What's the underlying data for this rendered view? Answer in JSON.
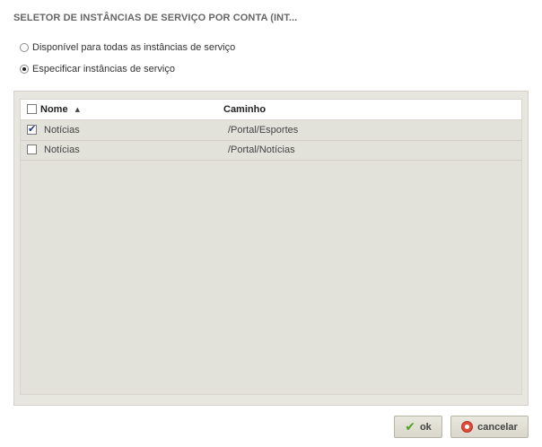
{
  "dialog": {
    "title": "SELETOR DE INSTÂNCIAS DE SERVIÇO POR CONTA (INT..."
  },
  "options": [
    {
      "label": "Disponível para todas as instâncias de serviço",
      "selected": false
    },
    {
      "label": "Especificar instâncias de serviço",
      "selected": true
    }
  ],
  "grid": {
    "columns": [
      "Nome",
      "Caminho"
    ],
    "sort_indicator": "▲",
    "rows": [
      {
        "checked": true,
        "name": "Notícias",
        "path": "/Portal/Esportes"
      },
      {
        "checked": false,
        "name": "Notícias",
        "path": "/Portal/Notícias"
      }
    ]
  },
  "buttons": {
    "ok_label": "ok",
    "cancel_label": "cancelar",
    "ok_icon": "checkmark-icon",
    "cancel_icon": "cancel-circle-icon"
  }
}
